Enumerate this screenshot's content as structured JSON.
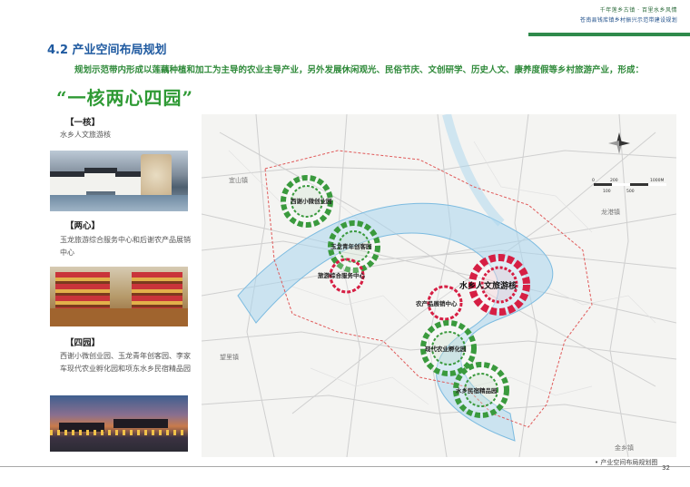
{
  "header": {
    "line1": "千年莲乡古镇 · 百里水乡风情",
    "line2": "苍南县钱库镇乡村振兴示范带建设规划"
  },
  "section": {
    "title": "4.2  产业空间布局规划",
    "intro": "规划示范带内形成以莲藕种植和加工为主导的农业主导产业，另外发展休闲观光、民俗节庆、文创研学、历史人文、康养度假等乡村旅游产业，形成：",
    "slogan": "“一核两心四园”"
  },
  "blocks": [
    {
      "label": "【一核】",
      "desc": "水乡人文旅游核"
    },
    {
      "label": "【两心】",
      "desc": "玉龙旅游综合服务中心和后谢农产品展销中心"
    },
    {
      "label": "【四园】",
      "desc": "西谢小微创业园、玉龙青年创客园、李家车现代农业孵化园和项东水乡民宿精品园"
    }
  ],
  "map": {
    "towns": [
      "宜山镇",
      "龙港镇",
      "金乡镇",
      "望里镇"
    ],
    "scale_labels": [
      "0",
      "200",
      "1000M",
      "100",
      "500"
    ],
    "nodes": {
      "core": "水乡人文旅游核",
      "center1": "旅游综合服务中心",
      "center2": "农产品展销中心",
      "park1": "西谢小微创业园",
      "park2": "玉龙青年创客园",
      "park3": "现代农业孵化园",
      "park4": "水乡民宿精品园"
    },
    "colors": {
      "river": "#a9d5ee",
      "green_ring": "#3a9a3d",
      "red_ring": "#d61f44",
      "boundary": "#e05a5a"
    }
  },
  "caption": "• 产业空间布局规划图",
  "page_number": "32"
}
